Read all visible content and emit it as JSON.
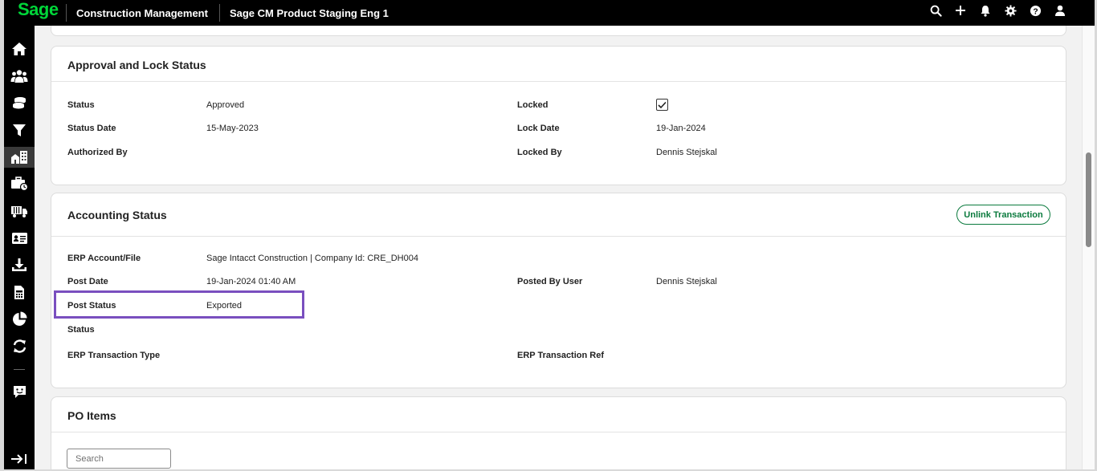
{
  "topbar": {
    "logo": "Sage",
    "app_title": "Construction Management",
    "company": "Sage CM Product Staging Eng 1",
    "icons": [
      "search-icon",
      "plus-icon",
      "bell-icon",
      "gear-icon",
      "help-icon",
      "user-icon"
    ]
  },
  "leftnav": {
    "items": [
      "home-icon",
      "people-icon",
      "coins-icon",
      "filter-icon",
      "buildings-icon",
      "briefcase-clock-icon",
      "truck-icon",
      "id-card-icon",
      "download-icon",
      "calculator-icon",
      "pie-chart-icon",
      "sync-icon",
      "feedback-icon",
      "expand-icon"
    ],
    "active": "buildings-icon"
  },
  "approval": {
    "title": "Approval and Lock Status",
    "status_label": "Status",
    "status_value": "Approved",
    "status_date_label": "Status Date",
    "status_date_value": "15-May-2023",
    "authorized_by_label": "Authorized By",
    "authorized_by_value": "",
    "locked_label": "Locked",
    "locked_value": true,
    "lock_date_label": "Lock Date",
    "lock_date_value": "19-Jan-2024",
    "locked_by_label": "Locked By",
    "locked_by_value": "Dennis Stejskal"
  },
  "accounting": {
    "title": "Accounting Status",
    "unlink_label": "Unlink Transaction",
    "erp_account_label": "ERP Account/File",
    "erp_account_value": "Sage Intacct Construction | Company Id: CRE_DH004",
    "post_date_label": "Post Date",
    "post_date_value": "19-Jan-2024 01:40 AM",
    "posted_by_label": "Posted By User",
    "posted_by_value": "Dennis Stejskal",
    "post_status_label": "Post Status",
    "post_status_value": "Exported",
    "status_label": "Status",
    "status_value": "",
    "erp_type_label": "ERP Transaction Type",
    "erp_type_value": "",
    "erp_ref_label": "ERP Transaction Ref",
    "erp_ref_value": ""
  },
  "po_items": {
    "title": "PO Items",
    "search_placeholder": "Search"
  },
  "colors": {
    "brand_green": "#00d639",
    "button_green": "#0a7a3d",
    "highlight_purple": "#7a4fbf"
  }
}
